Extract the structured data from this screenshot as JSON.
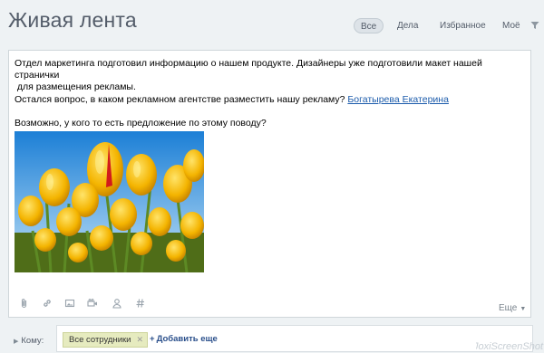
{
  "header": {
    "title": "Живая лента",
    "tabs": [
      {
        "label": "Все",
        "active": true
      },
      {
        "label": "Дела",
        "active": false
      },
      {
        "label": "Избранное",
        "active": false
      },
      {
        "label": "Моё",
        "active": false
      }
    ]
  },
  "post": {
    "line1": "Отдел маркетинга подготовил информацию о нашем продукте. Дизайнеры уже подготовили макет нашей странички",
    "line2": " для размещения рекламы.",
    "line3": "Остался вопрос, в каком рекламном агентстве разместить нашу рекламу? ",
    "mention": "Богатырева Екатерина",
    "line4": "Возможно, у кого то есть предложение по этому поводу?",
    "attachment": {
      "kind": "photo",
      "subject": "yellow-tulips"
    }
  },
  "toolbar": {
    "icons": [
      "paperclip-icon",
      "link-icon",
      "image-icon",
      "video-icon",
      "person-icon",
      "hashtag-icon"
    ],
    "more_label": "Еще"
  },
  "recipients": {
    "label": "Кому:",
    "chip_label": "Все сотрудники",
    "add_label": "Добавить еще"
  },
  "watermark": {
    "text": "JoxiScreenShot"
  },
  "colors": {
    "page_bg": "#eef2f4",
    "title": "#535c69",
    "mention": "#1b5bab",
    "chip_bg": "#e6ebbf",
    "add_link": "#2a4f8b"
  }
}
